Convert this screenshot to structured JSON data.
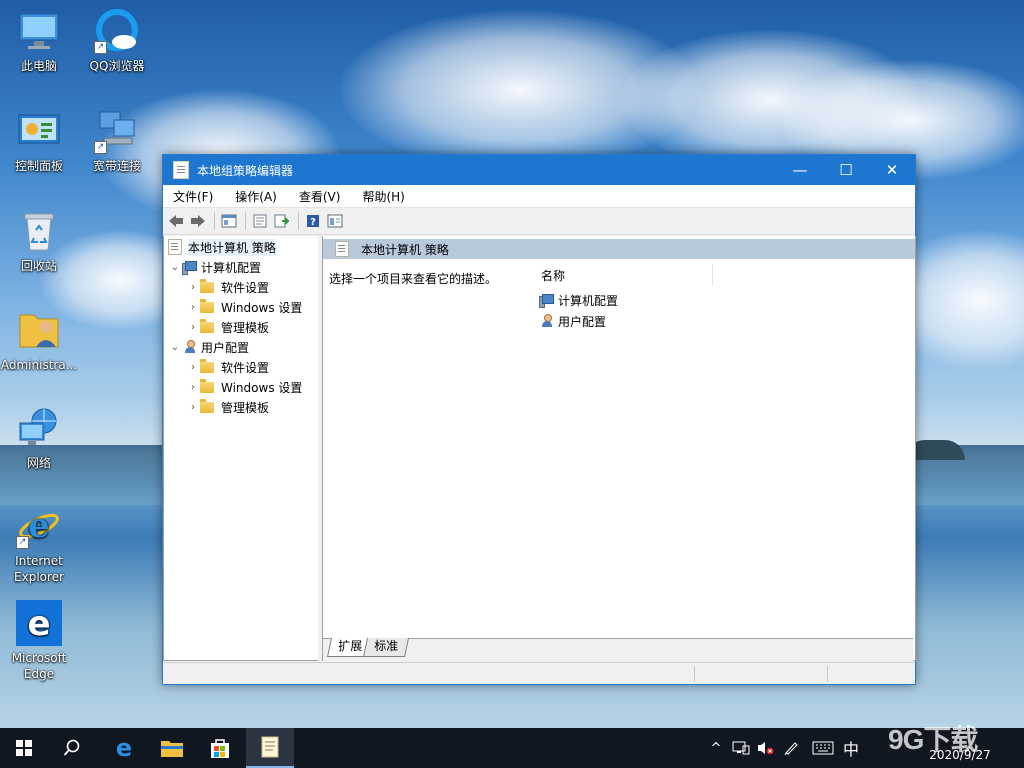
{
  "desktop": {
    "icons": [
      {
        "label": "此电脑",
        "icon": "computer-icon"
      },
      {
        "label": "QQ浏览器",
        "icon": "qq-browser-icon"
      },
      {
        "label": "控制面板",
        "icon": "control-panel-icon"
      },
      {
        "label": "宽带连接",
        "icon": "broadband-connection-icon"
      },
      {
        "label": "回收站",
        "icon": "recycle-bin-icon"
      },
      {
        "label": "Administra...",
        "icon": "user-folder-icon"
      },
      {
        "label": "网络",
        "icon": "network-icon"
      },
      {
        "label": "Internet Explorer",
        "icon": "internet-explorer-icon"
      },
      {
        "label": "Microsoft Edge",
        "icon": "edge-icon"
      }
    ]
  },
  "window": {
    "title": "本地组策略编辑器",
    "controls": {
      "minimize": "—",
      "maximize": "☐",
      "close": "✕"
    },
    "menu": [
      "文件(F)",
      "操作(A)",
      "查看(V)",
      "帮助(H)"
    ],
    "toolbar": [
      "back-arrow-icon",
      "forward-arrow-icon",
      "show-hide-tree-icon",
      "properties-icon",
      "export-list-icon",
      "help-icon",
      "extended-view-icon"
    ],
    "tree": {
      "root": "本地计算机 策略",
      "computer_config": {
        "label": "计算机配置",
        "children": [
          "软件设置",
          "Windows 设置",
          "管理模板"
        ]
      },
      "user_config": {
        "label": "用户配置",
        "children": [
          "软件设置",
          "Windows 设置",
          "管理模板"
        ]
      }
    },
    "detail": {
      "header": "本地计算机 策略",
      "description": "选择一个项目来查看它的描述。",
      "column_name": "名称",
      "items": [
        "计算机配置",
        "用户配置"
      ]
    },
    "tabs": [
      "扩展",
      "标准"
    ]
  },
  "taskbar": {
    "tray": {
      "chevron": "^",
      "ime": "中",
      "date": "2020/9/27"
    }
  },
  "watermark": "9G下载"
}
